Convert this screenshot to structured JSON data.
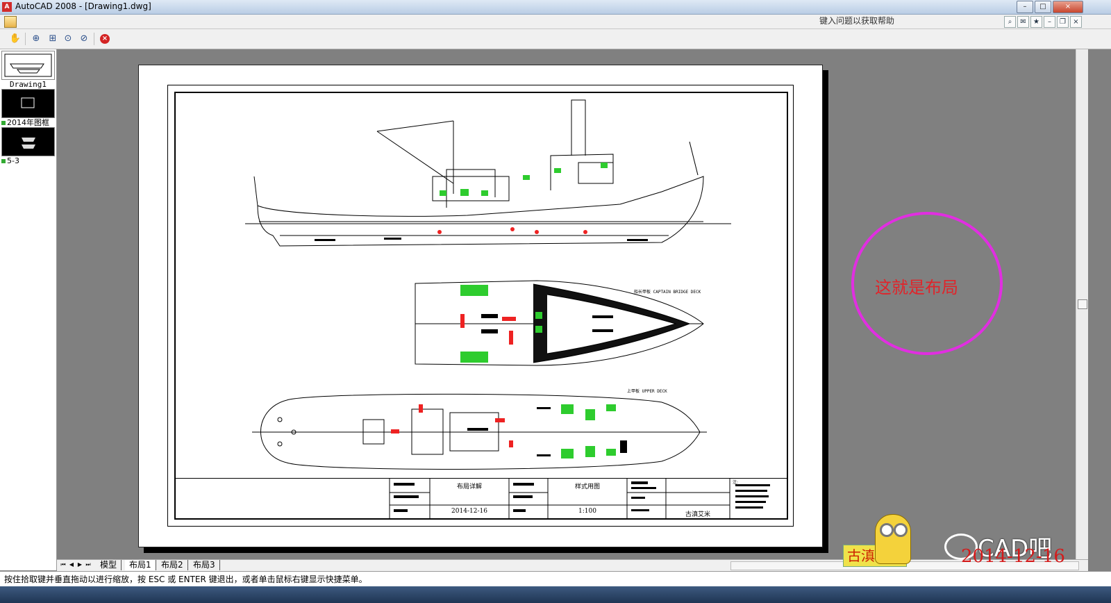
{
  "window": {
    "title": "AutoCAD 2008 - [Drawing1.dwg]",
    "app_icon": "A",
    "btn_min": "–",
    "btn_max": "□",
    "btn_close": "×"
  },
  "menubar": {
    "help_placeholder": "键入问题以获取帮助"
  },
  "toolbar": {
    "tools": [
      "pan-icon",
      "zoom-realtime-icon",
      "zoom-window-icon",
      "zoom-extents-icon",
      "zoom-previous-icon",
      "close-icon"
    ]
  },
  "sidebar": {
    "thumbnails": [
      {
        "label": "Drawing1"
      },
      {
        "label": "2014年图框"
      },
      {
        "label": "5-3"
      }
    ]
  },
  "drawing": {
    "deck1_label": "船长甲板  CAPTAIN BRIDGE DECK",
    "deck2_label": "上甲板  UPPER DECK",
    "titleblock": {
      "layout_detail": "布局详解",
      "sample_drawing": "样式用图",
      "date": "2014-12-16",
      "scale": "1:100",
      "author": "古滇艾米",
      "note_header": "注:"
    }
  },
  "annotation": {
    "text": "这就是布局",
    "color": "#e12ee1"
  },
  "tabs": {
    "items": [
      "模型",
      "布局1",
      "布局2",
      "布局3"
    ],
    "active": "布局1"
  },
  "command_line": {
    "text": "按住拾取键并垂直拖动以进行缩放，按 ESC 或 ENTER 键退出，或者单击鼠标右键显示快捷菜单。"
  },
  "watermark": {
    "brand": "CAD吧",
    "stamp": "古滇艾米",
    "date": "2014-12-16"
  }
}
